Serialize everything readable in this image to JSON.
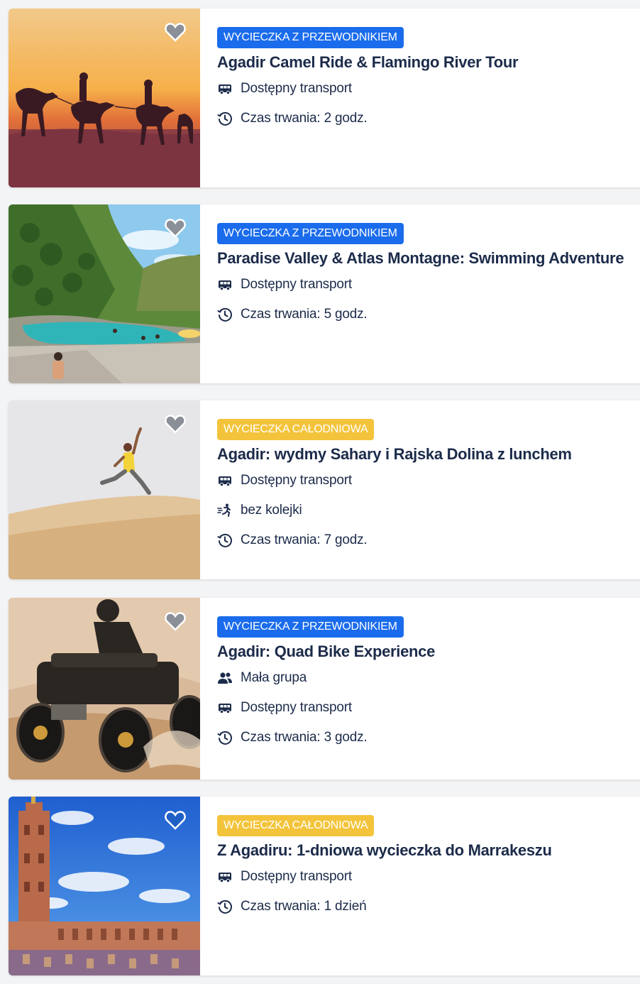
{
  "colors": {
    "badge_guided": "#1a6cec",
    "badge_fullday": "#f3c43b",
    "title_text": "#1c2b4a",
    "heart_grey": "#8a8f98",
    "heart_active": "#1f5fc6"
  },
  "cards": [
    {
      "badge": "WYCIECZKA Z PRZEWODNIKIEM",
      "badge_color": "blue",
      "title": "Agadir Camel Ride & Flamingo River Tour",
      "image_icon": "camel-sunset-image",
      "features": [
        {
          "icon": "bus-icon",
          "text": "Dostępny transport"
        },
        {
          "icon": "clock-icon",
          "text": "Czas trwania: 2 godz."
        }
      ]
    },
    {
      "badge": "WYCIECZKA Z PRZEWODNIKIEM",
      "badge_color": "blue",
      "title": "Paradise Valley & Atlas Montagne: Swimming Adventure",
      "image_icon": "paradise-valley-image",
      "features": [
        {
          "icon": "bus-icon",
          "text": "Dostępny transport"
        },
        {
          "icon": "clock-icon",
          "text": "Czas trwania: 5 godz."
        }
      ]
    },
    {
      "badge": "WYCIECZKA CAŁODNIOWA",
      "badge_color": "yellow",
      "title": "Agadir: wydmy Sahary i Rajska Dolina z lunchem",
      "image_icon": "desert-jump-image",
      "features": [
        {
          "icon": "bus-icon",
          "text": "Dostępny transport"
        },
        {
          "icon": "skip-line-icon",
          "text": "bez kolejki"
        },
        {
          "icon": "clock-icon",
          "text": "Czas trwania: 7 godz."
        }
      ]
    },
    {
      "badge": "WYCIECZKA Z PRZEWODNIKIEM",
      "badge_color": "blue",
      "title": "Agadir: Quad Bike Experience",
      "image_icon": "quad-bike-image",
      "features": [
        {
          "icon": "group-icon",
          "text": "Mała grupa"
        },
        {
          "icon": "bus-icon",
          "text": "Dostępny transport"
        },
        {
          "icon": "clock-icon",
          "text": "Czas trwania: 3 godz."
        }
      ]
    },
    {
      "badge": "WYCIECZKA CAŁODNIOWA",
      "badge_color": "yellow",
      "title": "Z Agadiru: 1-dniowa wycieczka do Marrakeszu",
      "image_icon": "marrakesh-mosque-image",
      "features": [
        {
          "icon": "bus-icon",
          "text": "Dostępny transport"
        },
        {
          "icon": "clock-icon",
          "text": "Czas trwania: 1 dzień"
        }
      ]
    }
  ]
}
